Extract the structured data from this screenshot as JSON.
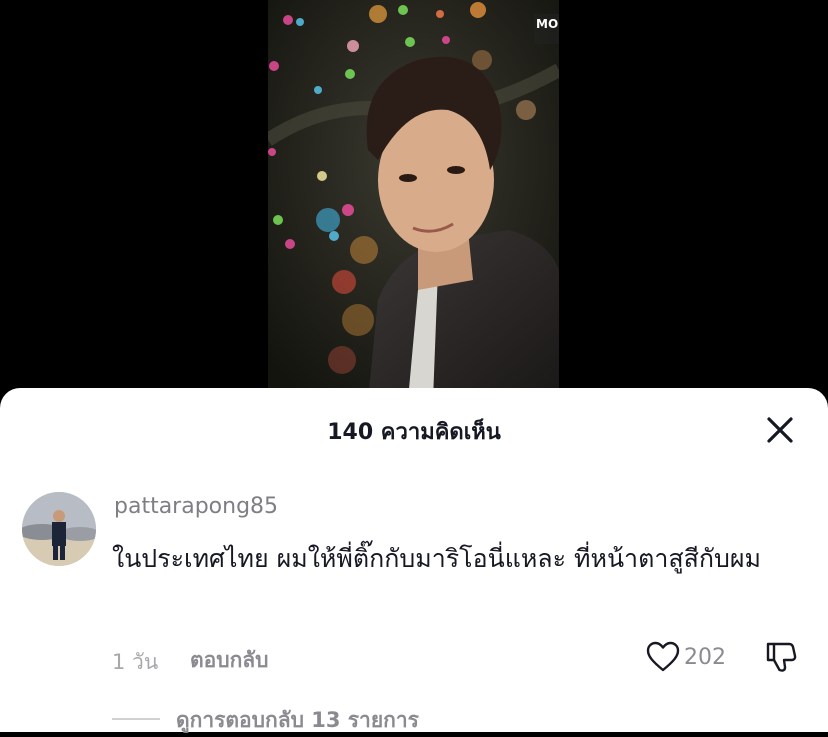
{
  "video": {
    "watermark": "MONO"
  },
  "comments_sheet": {
    "title": "140 ความคิดเห็น"
  },
  "comment": {
    "username": "pattarapong85",
    "text": "ในประเทศไทย ผมให้พี่ติ๊กกับมาริโอนี่แหละ ที่หน้าตาสูสีกับผม",
    "time": "1 วัน",
    "reply_label": "ตอบกลับ",
    "like_count": "202",
    "view_replies": "ดูการตอบกลับ 13 รายการ"
  },
  "icons": {
    "close": "close-icon",
    "like": "heart-outline-icon",
    "dislike": "thumbs-down-icon"
  },
  "colors": {
    "text_primary": "#161823",
    "text_secondary": "#8a8b91",
    "sheet_bg": "#ffffff"
  }
}
